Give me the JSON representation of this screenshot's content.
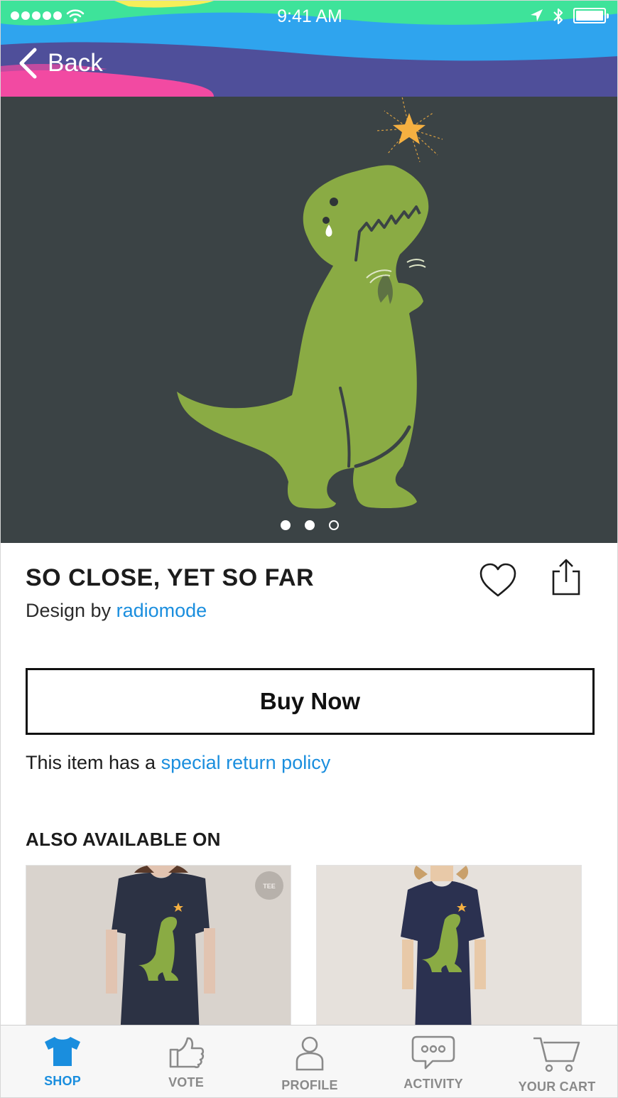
{
  "status_bar": {
    "time": "9:41 AM"
  },
  "nav": {
    "back_label": "Back"
  },
  "hero": {
    "slide_count": 3,
    "active_slide": 2
  },
  "product": {
    "title": "SO CLOSE, YET SO FAR",
    "byline_prefix": "Design by",
    "designer": "radiomode"
  },
  "actions": {
    "buy_label": "Buy Now"
  },
  "policy": {
    "prefix": "This item has a",
    "link": "special return policy"
  },
  "also_available": {
    "heading": "ALSO AVAILABLE ON",
    "items": [
      {
        "badge": "TEE"
      },
      {
        "badge": ""
      }
    ]
  },
  "tabs": [
    {
      "label": "SHOP",
      "icon": "tshirt-icon",
      "active": true
    },
    {
      "label": "VOTE",
      "icon": "thumbs-up-icon",
      "active": false
    },
    {
      "label": "PROFILE",
      "icon": "user-icon",
      "active": false
    },
    {
      "label": "ACTIVITY",
      "icon": "chat-bubble-icon",
      "active": false
    },
    {
      "label": "YOUR CART",
      "icon": "cart-icon",
      "active": false
    }
  ],
  "colors": {
    "accent": "#1a8ede",
    "hero_bg": "#3b4345",
    "dino_green": "#8aab44",
    "star": "#f5b041"
  }
}
